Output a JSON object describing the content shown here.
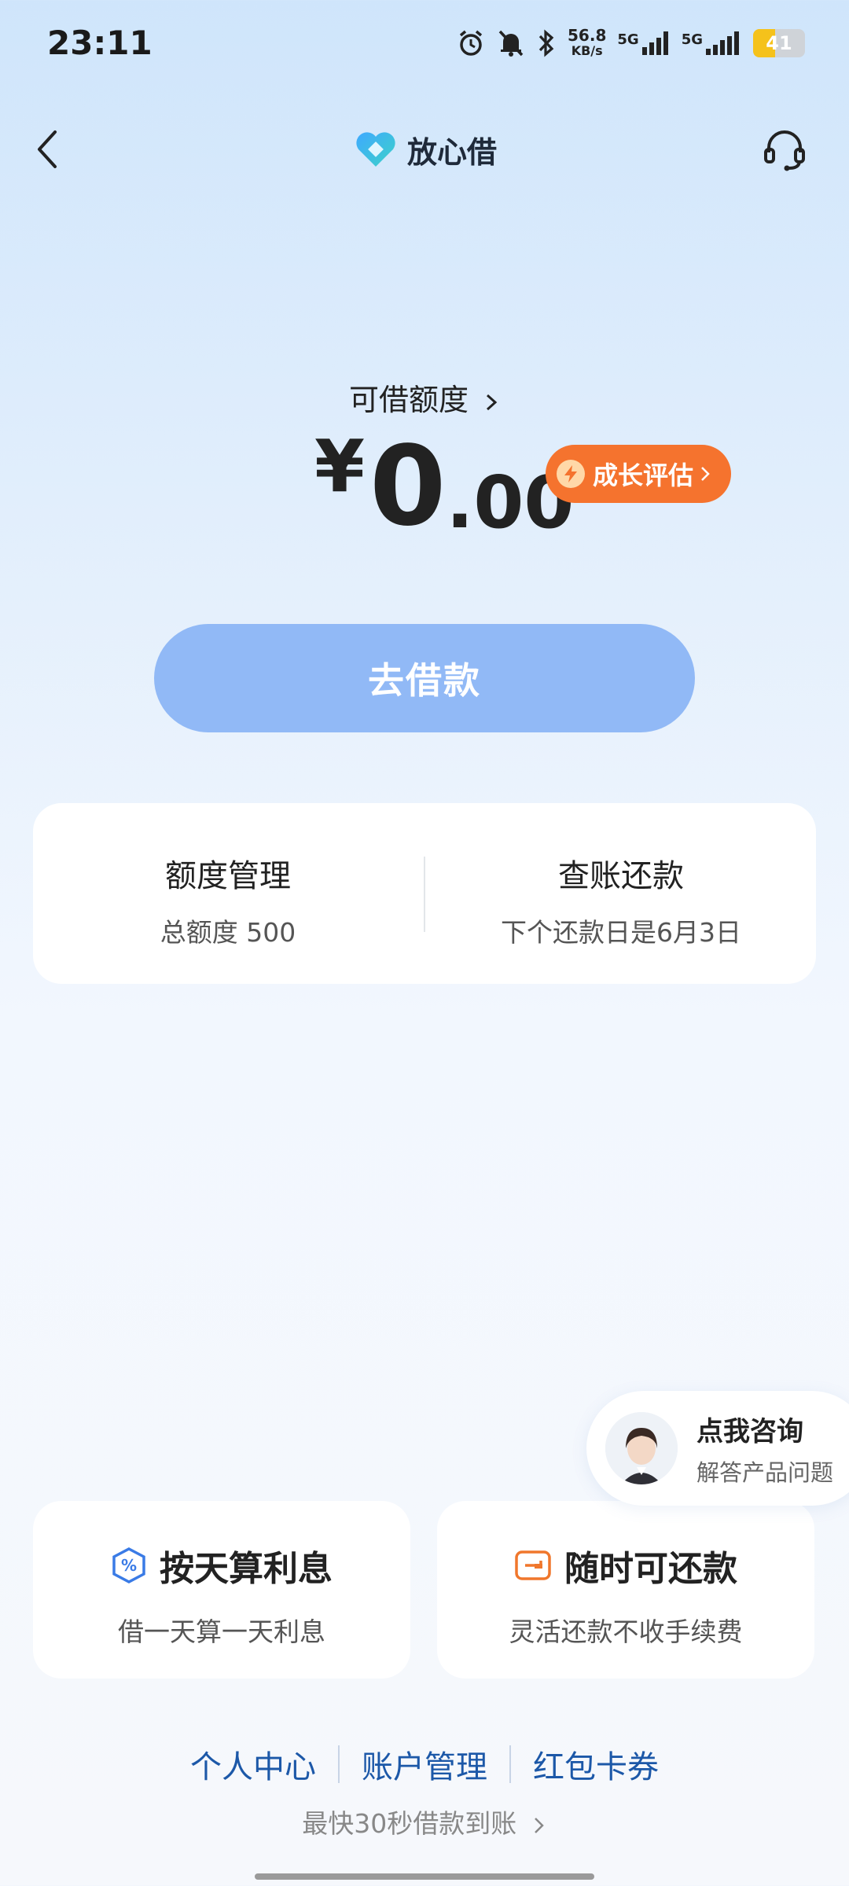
{
  "status_bar": {
    "time": "23:11",
    "net_speed_value": "56.8",
    "net_speed_unit": "KB/s",
    "sim1_label": "5G",
    "sim2_label": "5G",
    "battery": "41",
    "icons": [
      "alarm-icon",
      "mute-bell-icon",
      "bluetooth-icon",
      "signal-icon",
      "battery-icon"
    ]
  },
  "header": {
    "brand_name": "放心借",
    "back_icon": "back-arrow-icon",
    "support_icon": "headset-icon"
  },
  "quota": {
    "label": "可借额度",
    "currency": "¥",
    "amount_int": "0",
    "amount_dec": ".00",
    "growth_badge": "成长评估"
  },
  "borrow_button": "去借款",
  "manage": {
    "quota_title": "额度管理",
    "quota_sub": "总额度 500",
    "repay_title": "查账还款",
    "repay_sub": "下个还款日是6月3日"
  },
  "consult": {
    "title": "点我咨询",
    "subtitle": "解答产品问题"
  },
  "features": [
    {
      "title": "按天算利息",
      "subtitle": "借一天算一天利息",
      "icon": "percent-shield-icon"
    },
    {
      "title": "随时可还款",
      "subtitle": "灵活还款不收手续费",
      "icon": "wallet-card-icon"
    }
  ],
  "links": [
    "个人中心",
    "账户管理",
    "红包卡券"
  ],
  "fast_text": "最快30秒借款到账",
  "colors": {
    "accent_blue": "#91b9f6",
    "badge_orange": "#f5732e",
    "link_blue": "#1c58a8"
  }
}
